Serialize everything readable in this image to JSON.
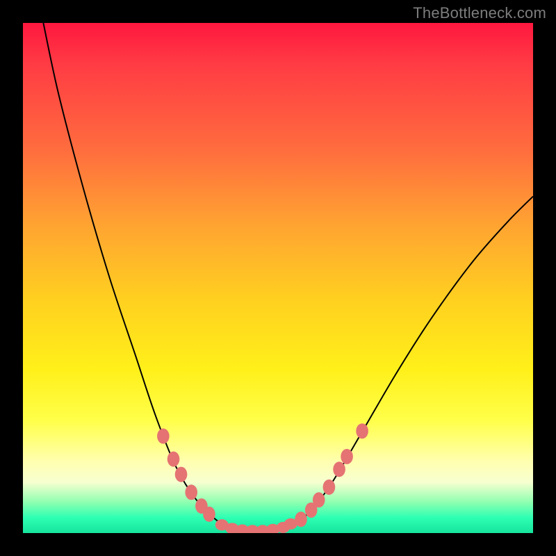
{
  "watermark": "TheBottleneck.com",
  "chart_data": {
    "type": "line",
    "title": "",
    "xlabel": "",
    "ylabel": "",
    "xlim": [
      0,
      100
    ],
    "ylim": [
      0,
      100
    ],
    "curve_left": {
      "name": "left-branch",
      "points": [
        {
          "x": 4,
          "y": 100
        },
        {
          "x": 7,
          "y": 86
        },
        {
          "x": 12,
          "y": 67
        },
        {
          "x": 17,
          "y": 50
        },
        {
          "x": 22,
          "y": 35
        },
        {
          "x": 26,
          "y": 23
        },
        {
          "x": 30,
          "y": 13
        },
        {
          "x": 34,
          "y": 6.5
        },
        {
          "x": 38,
          "y": 2.5
        },
        {
          "x": 42,
          "y": 0.5
        }
      ]
    },
    "curve_flat": {
      "name": "valley",
      "points": [
        {
          "x": 42,
          "y": 0.5
        },
        {
          "x": 50,
          "y": 0.5
        }
      ]
    },
    "curve_right": {
      "name": "right-branch",
      "points": [
        {
          "x": 50,
          "y": 0.5
        },
        {
          "x": 55,
          "y": 3
        },
        {
          "x": 60,
          "y": 9
        },
        {
          "x": 66,
          "y": 19
        },
        {
          "x": 73,
          "y": 31
        },
        {
          "x": 80,
          "y": 42
        },
        {
          "x": 88,
          "y": 53
        },
        {
          "x": 95,
          "y": 61
        },
        {
          "x": 100,
          "y": 66
        }
      ]
    },
    "markers_left": [
      {
        "x": 27.5,
        "y": 19
      },
      {
        "x": 29.5,
        "y": 14.5
      },
      {
        "x": 31,
        "y": 11.5
      },
      {
        "x": 33,
        "y": 8
      },
      {
        "x": 35,
        "y": 5.3
      },
      {
        "x": 36.5,
        "y": 3.7
      }
    ],
    "markers_right": [
      {
        "x": 54.5,
        "y": 2.7
      },
      {
        "x": 56.5,
        "y": 4.5
      },
      {
        "x": 58,
        "y": 6.5
      },
      {
        "x": 60,
        "y": 9
      },
      {
        "x": 62,
        "y": 12.5
      },
      {
        "x": 63.5,
        "y": 15
      },
      {
        "x": 66.5,
        "y": 20
      }
    ],
    "markers_bottom": [
      {
        "x": 39,
        "y": 1.6
      },
      {
        "x": 41,
        "y": 0.9
      },
      {
        "x": 43,
        "y": 0.6
      },
      {
        "x": 45,
        "y": 0.5
      },
      {
        "x": 47,
        "y": 0.5
      },
      {
        "x": 49,
        "y": 0.7
      },
      {
        "x": 51,
        "y": 1.1
      },
      {
        "x": 52.5,
        "y": 1.8
      }
    ],
    "marker_color": "#e57373",
    "curve_color": "#000000"
  }
}
